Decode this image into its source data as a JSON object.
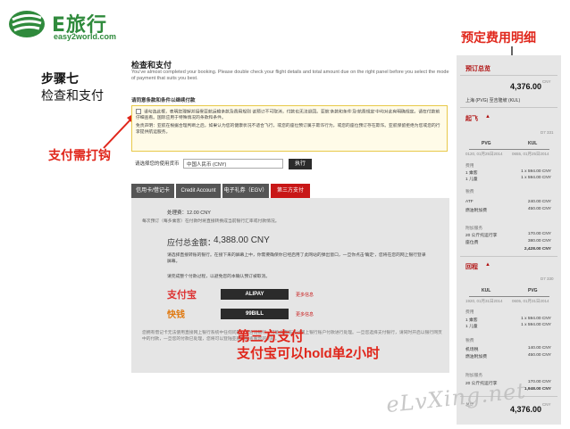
{
  "brand": {
    "name": "E旅行",
    "domain": "easy2world.com",
    "green": "#2f8a3c"
  },
  "annotations": {
    "step_title": "步骤七",
    "step_subtitle": "检查和支付",
    "hook_note": "支付需打钩",
    "price_detail_note": "预定费用明细",
    "third_party_note": "第三方支付",
    "hold_note": "支付宝可以hold单2小时",
    "red": "#e0261b"
  },
  "main": {
    "title": "检查和支付",
    "description": "You've almost completed your booking. Please double check your flight details and total amount due on the right panel before you select the mode of payment that suits you best.",
    "terms_title": "请同意条款和条件以继续付款",
    "terms_text1": "请勾选此框，表明您理解并接受亚航运输条款及费用规则 该预订不可取消，付款也无法退回。亚航'条款和条件'及'航费规定'中均对此有明确规定。请在付款前仔细查看。国际应用于特殊情况的条款和条件。",
    "terms_text2": "免责声明：亚航在根据合理判断之后，如果认为您的健康状况不适合飞行，或您的座位预订属于欺诈行为，或您的座位预订存在欺诈。亚航保留拒绝为您或您的行李提供航运服务。",
    "currency_label": "请选择您的使用货币",
    "currency_value": "中国人民币 (CNY)",
    "execute_label": "执行",
    "tabs": [
      {
        "label": "信用卡/借记卡",
        "active": false
      },
      {
        "label": "Credit Account",
        "active": false
      },
      {
        "label": "电子礼券（EGV）",
        "active": false
      },
      {
        "label": "第三方支付",
        "active": true
      }
    ],
    "accent": "#c81717"
  },
  "payment": {
    "fee_text": "处理费：12.00 CNY",
    "note1": "每次预订（每多乘客）在付款时将直接转换成当前银行汇率或付款情况。",
    "total_label": "应付总金额：",
    "total_value": "4,388.00 CNY",
    "note2": "请选择直接转账的银行。在接下来的屏幕上中，你需要确保你已经启用了此网站的弹出窗口，一旦你点击'确定'，您将在您的网上银行登录屏幕。",
    "note3": "请完成整个付款过程，以避免您的本确认预订被取消。",
    "providers": [
      {
        "logo": "支付宝",
        "button": "ALIPAY",
        "more": "更多信息"
      },
      {
        "logo": "快钱",
        "button": "99BILL",
        "more": "更多信息"
      }
    ],
    "note4": "您拥有借记卡无法使用直接网上银行系统中任何问题，请咨询银行。可能会面临通过网上银行账户付款进行处理。一旦您选择支付银行，请同时开启以银行网页中的付款，一旦您的付款已处理，您将可以登陆亚航网站查看您的航班。"
  },
  "price_panel": {
    "header": "预订总览",
    "total_amount": "4,376.00",
    "currency": "CNY",
    "route": "上海 (PVG) 至吉隆坡 (KUL)",
    "depart": {
      "title": "起飞",
      "flight_no": "D7 331",
      "from": "PVG",
      "to": "KUL",
      "from_time": "0120, 01月25日2014",
      "to_time": "0655, 01月25日2014",
      "fare_title": "费用",
      "fare_adult": "1 乘客",
      "fare_adult_val": "1 x 594.00 CNY",
      "fare_child": "1 儿童",
      "fare_child_val": "1 x 594.00 CNY",
      "tax_title": "税费",
      "tax_atf": "ATF",
      "tax_atf_val": "240.00 CNY",
      "tax_fuel": "燃油附加费",
      "tax_fuel_val": "450.00 CNY",
      "addon_title": "附加服务",
      "addon_bag": "20 公斤托运行李",
      "addon_bag_val": "170.00 CNY",
      "addon_seat": "座位费",
      "addon_seat_val": "380.00 CNY",
      "subtotal": "2,428.00 CNY"
    },
    "return": {
      "title": "回程",
      "flight_no": "D7 330",
      "from": "KUL",
      "to": "PVG",
      "from_time": "1920, 01月31日2014",
      "to_time": "0605, 01月31日2014",
      "fare_title": "费用",
      "fare_adult": "1 乘客",
      "fare_adult_val": "1 x 594.00 CNY",
      "fare_child": "1 儿童",
      "fare_child_val": "1 x 594.00 CNY",
      "tax_title": "税费",
      "tax_atf": "机场税",
      "tax_atf_val": "140.00 CNY",
      "tax_fuel": "燃油附加费",
      "tax_fuel_val": "450.00 CNY",
      "addon_title": "附加服务",
      "addon_bag": "20 公斤托运行李",
      "addon_bag_val": "170.00 CNY",
      "subtotal": "1,948.00 CNY"
    },
    "bottom_label": "总计",
    "bottom_total": "4,376.00",
    "bottom_currency": "CNY"
  },
  "watermark": "eLvXing.net"
}
